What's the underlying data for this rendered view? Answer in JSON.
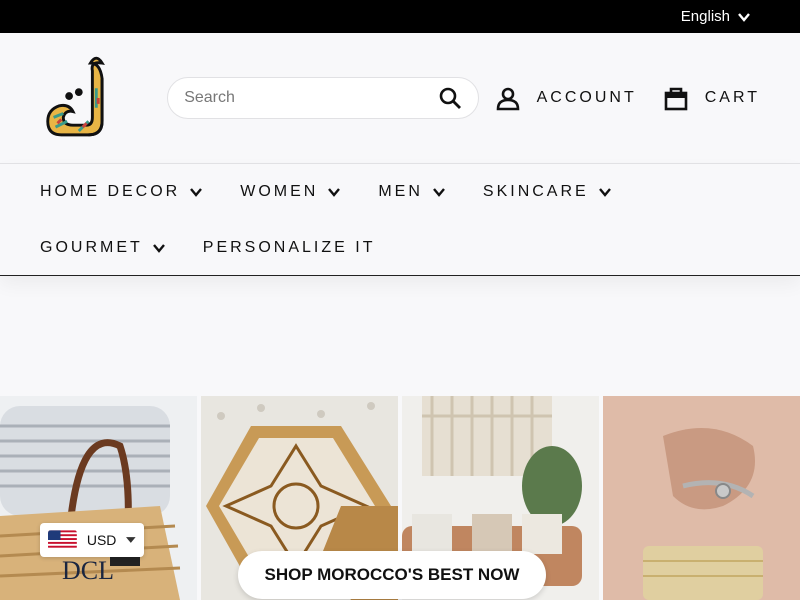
{
  "topbar": {
    "language": "English"
  },
  "header": {
    "search_placeholder": "Search",
    "account_label": "ACCOUNT",
    "cart_label": "CART"
  },
  "nav": {
    "items": [
      {
        "label": "HOME DECOR"
      },
      {
        "label": "WOMEN"
      },
      {
        "label": "MEN"
      },
      {
        "label": "SKINCARE"
      },
      {
        "label": "GOURMET"
      },
      {
        "label": "PERSONALIZE IT"
      }
    ]
  },
  "hero": {
    "cta_label": "SHOP MOROCCO'S BEST NOW",
    "basket_text": "DCL"
  },
  "currency": {
    "code": "USD"
  },
  "colors": {
    "topbar": "#000000",
    "page_bg": "#f8f8fa",
    "text": "#111111"
  }
}
